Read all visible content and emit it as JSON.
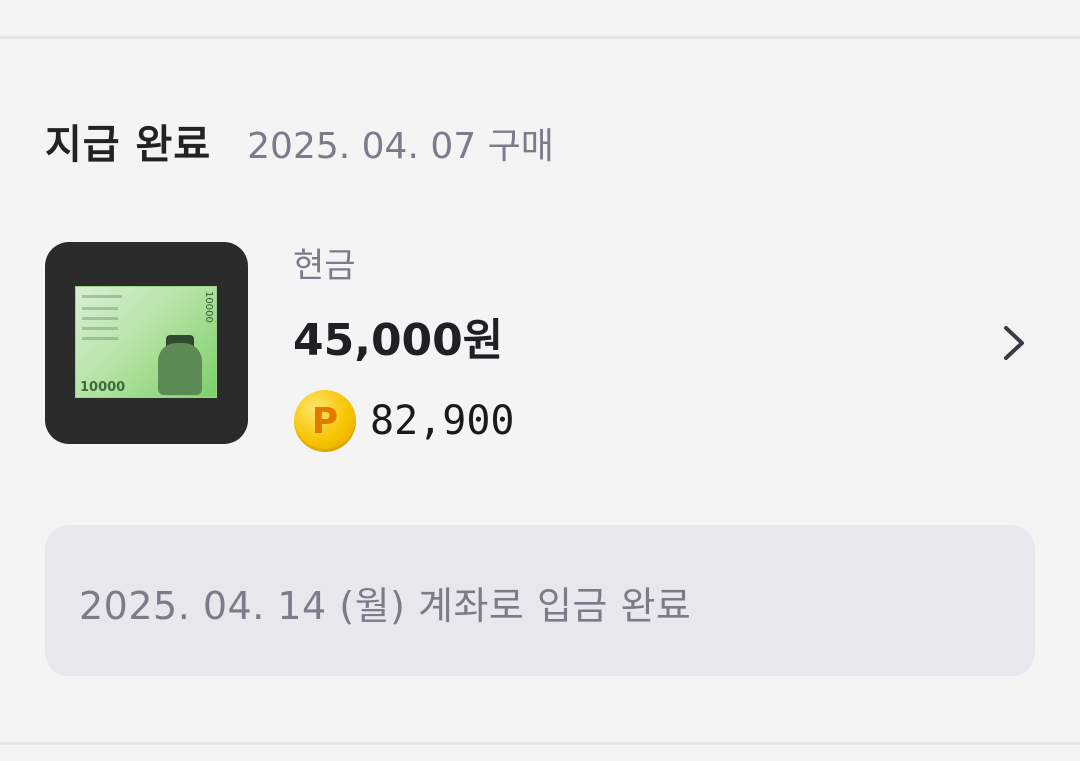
{
  "order": {
    "status": "지급 완료",
    "purchase_date": "2025. 04. 07 구매"
  },
  "item": {
    "thumbnail_icon": "banknote-10000-won-image",
    "category": "현금",
    "amount": "45,000원",
    "points_icon": "p-coin-icon",
    "points_coin_letter": "P",
    "points": "82,900",
    "chevron_icon": "chevron-right-icon"
  },
  "deposit": {
    "message": "2025. 04. 14 (월) 계좌로 입금 완료"
  },
  "colors": {
    "background": "#f4f4f5",
    "muted_text": "#7a7c8a",
    "primary_text": "#1f1f24",
    "coin": "#f7c400",
    "deposit_box": "#e7e7ed"
  }
}
